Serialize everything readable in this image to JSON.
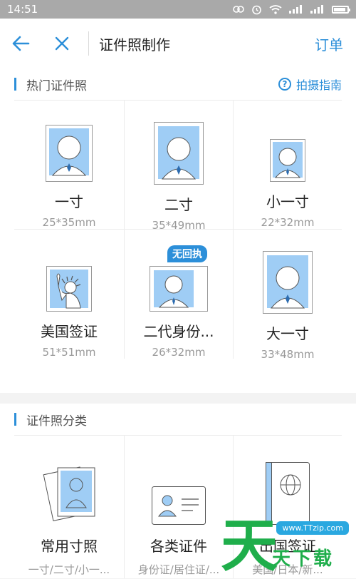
{
  "status": {
    "time": "14:51"
  },
  "nav": {
    "title": "证件照制作",
    "order": "订单"
  },
  "hot": {
    "title": "热门证件照",
    "guide": "拍摄指南",
    "items": [
      {
        "name": "一寸",
        "size": "25*35mm"
      },
      {
        "name": "二寸",
        "size": "35*49mm"
      },
      {
        "name": "小一寸",
        "size": "22*32mm"
      },
      {
        "name": "美国签证",
        "size": "51*51mm"
      },
      {
        "name": "二代身份...",
        "size": "26*32mm",
        "badge": "无回执"
      },
      {
        "name": "大一寸",
        "size": "33*48mm"
      }
    ]
  },
  "category": {
    "title": "证件照分类",
    "items": [
      {
        "name": "常用寸照",
        "sub": "一寸/二寸/小一..."
      },
      {
        "name": "各类证件",
        "sub": "身份证/居住证/..."
      },
      {
        "name": "出国签证",
        "sub": "美国/日本/新..."
      }
    ]
  },
  "watermark": {
    "big": "天",
    "text": "天下载",
    "url": "www.TTzip.com"
  },
  "colors": {
    "accent": "#2c8fd9",
    "photo_bg": "#9fcdf5"
  }
}
